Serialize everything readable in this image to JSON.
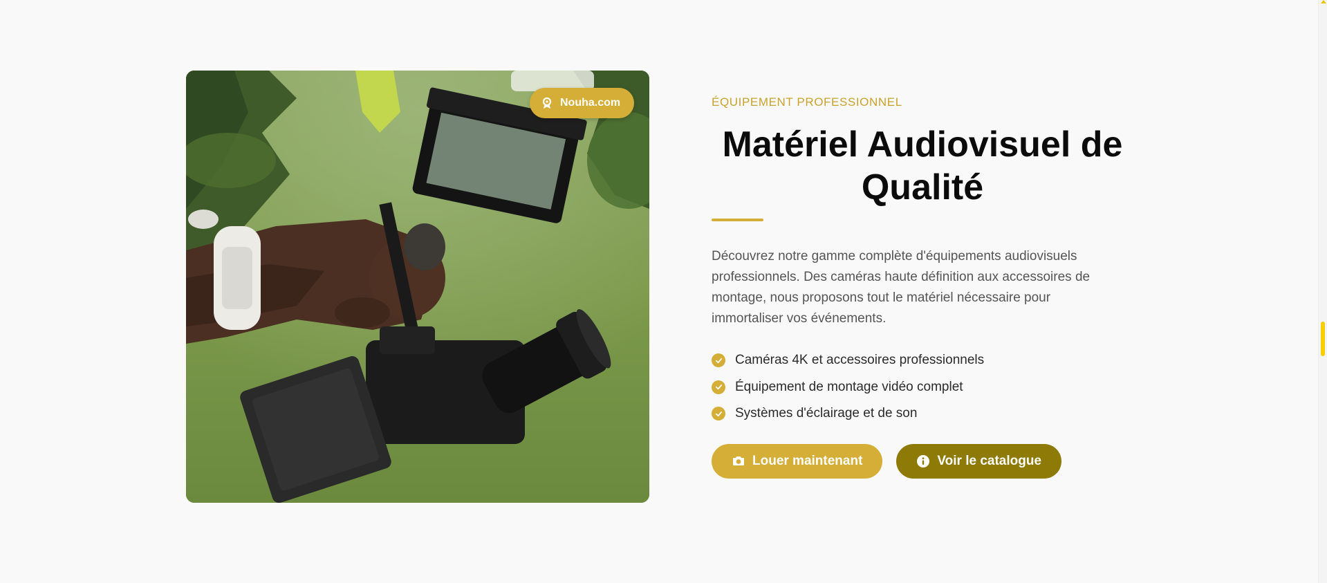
{
  "badge": {
    "label": "Nouha.com",
    "icon": "award-icon"
  },
  "section": {
    "eyebrow": "ÉQUIPEMENT PROFESSIONNEL",
    "title": "Matériel Audiovisuel de Qualité",
    "description": "Découvrez notre gamme complète d'équipements audiovisuels professionnels. Des caméras haute définition aux accessoires de montage, nous proposons tout le matériel nécessaire pour immortaliser vos événements.",
    "features": [
      {
        "label": "Caméras 4K et accessoires professionnels",
        "icon": "check-circle-icon"
      },
      {
        "label": "Équipement de montage vidéo complet",
        "icon": "check-circle-icon"
      },
      {
        "label": "Systèmes d'éclairage et de son",
        "icon": "check-circle-icon"
      }
    ]
  },
  "buttons": {
    "primary": {
      "label": "Louer maintenant",
      "icon": "camera-icon"
    },
    "secondary": {
      "label": "Voir le catalogue",
      "icon": "info-icon"
    }
  },
  "colors": {
    "accent": "#d4ae37",
    "accent_dark": "#8e7a06",
    "background": "#f9f9f9",
    "title": "#0b0b0b",
    "text": "#555555"
  }
}
